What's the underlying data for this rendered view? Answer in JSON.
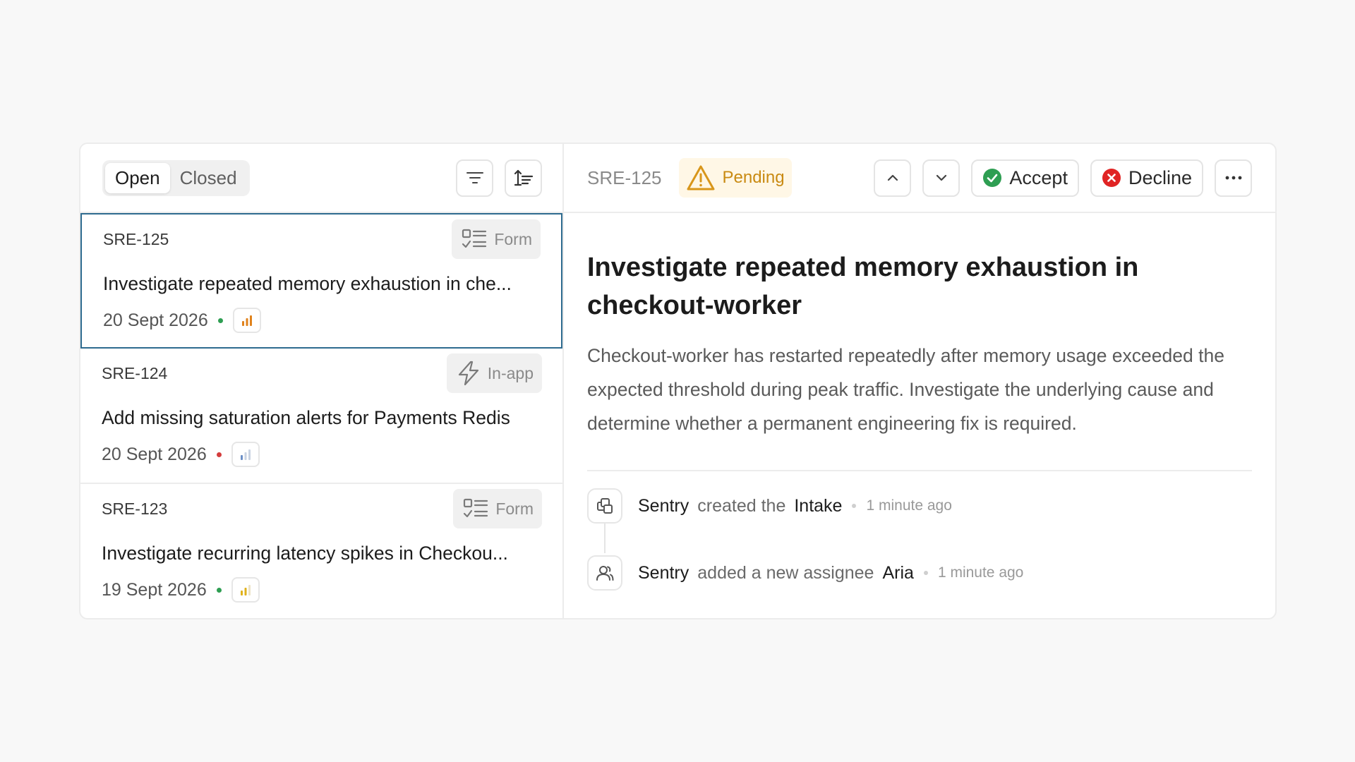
{
  "filters": {
    "open_label": "Open",
    "closed_label": "Closed",
    "active": "Open"
  },
  "list": {
    "items": [
      {
        "id": "SRE-125",
        "tag_label": "Form",
        "tag_icon": "form-icon",
        "title": "Investigate repeated memory exhaustion in che...",
        "date": "20 Sept 2026",
        "status_dot_color": "#2e9e52",
        "priority": "high",
        "priority_color": "#e0821c"
      },
      {
        "id": "SRE-124",
        "tag_label": "In-app",
        "tag_icon": "lightning-icon",
        "title": "Add missing saturation alerts for Payments Redis",
        "date": "20 Sept 2026",
        "status_dot_color": "#d43c3c",
        "priority": "low",
        "priority_color": "#6b8fc7"
      },
      {
        "id": "SRE-123",
        "tag_label": "Form",
        "tag_icon": "form-icon",
        "title": "Investigate recurring latency spikes in Checkou...",
        "date": "19 Sept 2026",
        "status_dot_color": "#2e9e52",
        "priority": "medium",
        "priority_color": "#e0b21c"
      }
    ]
  },
  "detail": {
    "id": "SRE-125",
    "status_label": "Pending",
    "status_color": "#c98a12",
    "accept_label": "Accept",
    "decline_label": "Decline",
    "title": "Investigate repeated memory exhaustion in checkout-worker",
    "description": "Checkout-worker has restarted repeatedly after memory usage exceeded the expected threshold during peak traffic. Investigate the underlying cause and determine whether a permanent engineering fix is required.",
    "activity": [
      {
        "icon": "intake-icon",
        "actor": "Sentry",
        "verb": "created the",
        "object": "Intake",
        "time": "1 minute ago"
      },
      {
        "icon": "user-icon",
        "actor": "Sentry",
        "verb": "added a new assignee",
        "object": "Aria",
        "time": "1 minute ago"
      }
    ]
  }
}
